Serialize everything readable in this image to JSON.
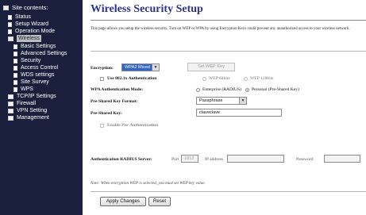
{
  "sidebar": {
    "root": "Site contents:",
    "items": [
      {
        "label": "Status",
        "icon": "doc-icon"
      },
      {
        "label": "Setup Wizard",
        "icon": "doc-icon"
      },
      {
        "label": "Operation Mode",
        "icon": "doc-icon"
      },
      {
        "label": "Wireless",
        "icon": "folder-open-icon",
        "selected": true
      },
      {
        "label": "Basic Settings",
        "icon": "doc-icon"
      },
      {
        "label": "Advanced Settings",
        "icon": "doc-icon"
      },
      {
        "label": "Security",
        "icon": "doc-icon"
      },
      {
        "label": "Access Control",
        "icon": "doc-icon"
      },
      {
        "label": "WDS settings",
        "icon": "doc-icon"
      },
      {
        "label": "Site Survey",
        "icon": "doc-icon"
      },
      {
        "label": "WPS",
        "icon": "doc-icon"
      },
      {
        "label": "TCP/IP Settings",
        "icon": "folder-icon"
      },
      {
        "label": "Firewall",
        "icon": "folder-icon"
      },
      {
        "label": "VPN Setting",
        "icon": "folder-icon"
      },
      {
        "label": "Management",
        "icon": "folder-icon"
      }
    ]
  },
  "page": {
    "title": "Wireless Security Setup",
    "description": "This page allows you setup the wireless security. Turn on WEP or WPA by using Encryption Keys could prevent any unauthorized access to your wireless network."
  },
  "form": {
    "encryption_label": "Encryption:",
    "encryption_value": "WPA2 Mixed",
    "set_wep_key_label": "Set WEP Key",
    "use_8021x_label": "Use 802.1x Authentication",
    "wep_64_label": "WEP 64bits",
    "wep_128_label": "WEP 128bits",
    "wpa_auth_mode_label": "WPA Authentication Mode:",
    "enterprise_label": "Enterprise (RADIUS)",
    "personal_label": "Personal (Pre-Shared Key)",
    "psk_format_label": "Pre-Shared Key Format:",
    "psk_format_value": "Passphrase",
    "psk_label": "Pre-Shared Key:",
    "psk_value": "claveclave",
    "enable_preauth_label": "Enable Pre-Authentication",
    "radius_label": "Authentication RADIUS Server:",
    "port_label": "Port",
    "port_value": "1812",
    "ip_label": "IP address",
    "ip_value": "",
    "password_label": "Password",
    "password_value": ""
  },
  "note": "Note: When encryption WEP is selected, you must set WEP key value.",
  "buttons": {
    "apply": "Apply Changes",
    "reset": "Reset"
  },
  "colors": {
    "sidebar_bg": "#1a1f3c",
    "title": "#2a3490",
    "select_highlight": "#3165c7"
  }
}
